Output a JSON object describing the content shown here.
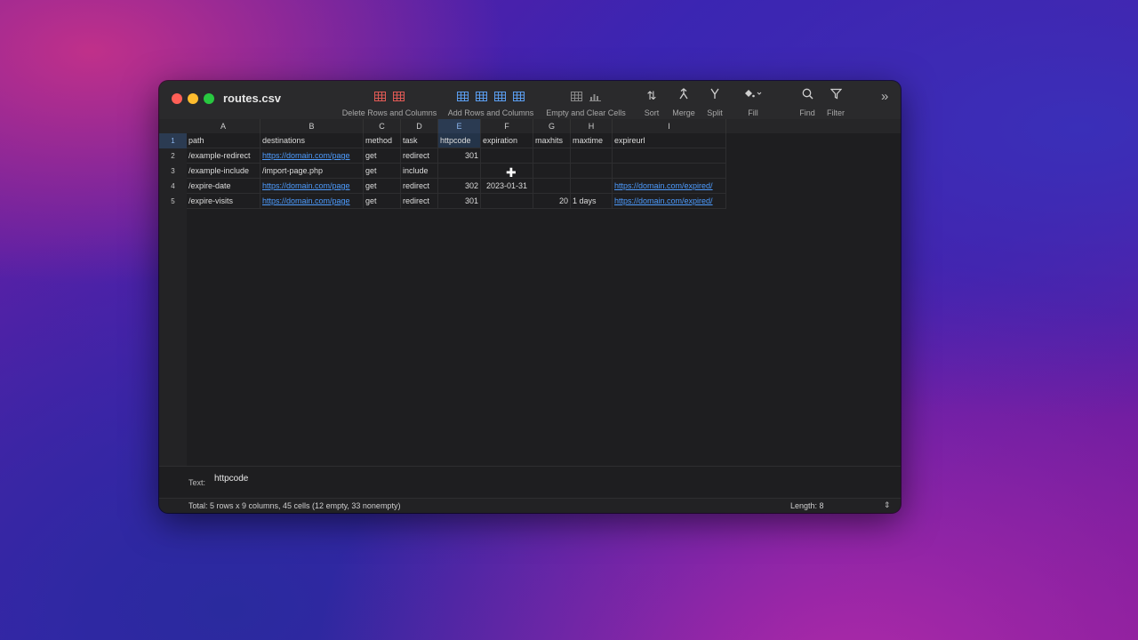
{
  "window": {
    "title": "routes.csv"
  },
  "toolbar": {
    "delete_label": "Delete Rows and Columns",
    "add_label": "Add Rows and Columns",
    "empty_label": "Empty and Clear Cells",
    "sort_label": "Sort",
    "merge_label": "Merge",
    "split_label": "Split",
    "fill_label": "Fill",
    "find_label": "Find",
    "filter_label": "Filter",
    "overflow_glyph": "»"
  },
  "columns": [
    "A",
    "B",
    "C",
    "D",
    "E",
    "F",
    "G",
    "H",
    "I"
  ],
  "rows": [
    "1",
    "2",
    "3",
    "4",
    "5"
  ],
  "cells": [
    [
      "path",
      "destinations",
      "method",
      "task",
      "httpcode",
      "expiration",
      "maxhits",
      "maxtime",
      "expireurl"
    ],
    [
      "/example-redirect",
      "https://domain.com/page",
      "get",
      "redirect",
      "301",
      "",
      "",
      "",
      ""
    ],
    [
      "/example-include",
      "/import-page.php",
      "get",
      "include",
      "",
      "",
      "",
      "",
      ""
    ],
    [
      "/expire-date",
      "https://domain.com/page",
      "get",
      "redirect",
      "302",
      "2023-01-31",
      "",
      "",
      "https://domain.com/expired/"
    ],
    [
      "/expire-visits",
      "https://domain.com/page",
      "get",
      "redirect",
      "301",
      "",
      "20",
      "1 days",
      "https://domain.com/expired/"
    ]
  ],
  "selected": {
    "column": "E",
    "row": "1"
  },
  "editor": {
    "label": "Text:",
    "value": "httpcode"
  },
  "status": {
    "summary": "Total: 5 rows x 9 columns, 45 cells (12 empty, 33 nonempty)",
    "length": "Length: 8",
    "stepper_glyph": "⇕"
  },
  "colors": {
    "link": "#4d9cff",
    "selection": "#2b3b52",
    "close": "#ff5f57",
    "minimize": "#febc2e",
    "zoom": "#28c840"
  }
}
